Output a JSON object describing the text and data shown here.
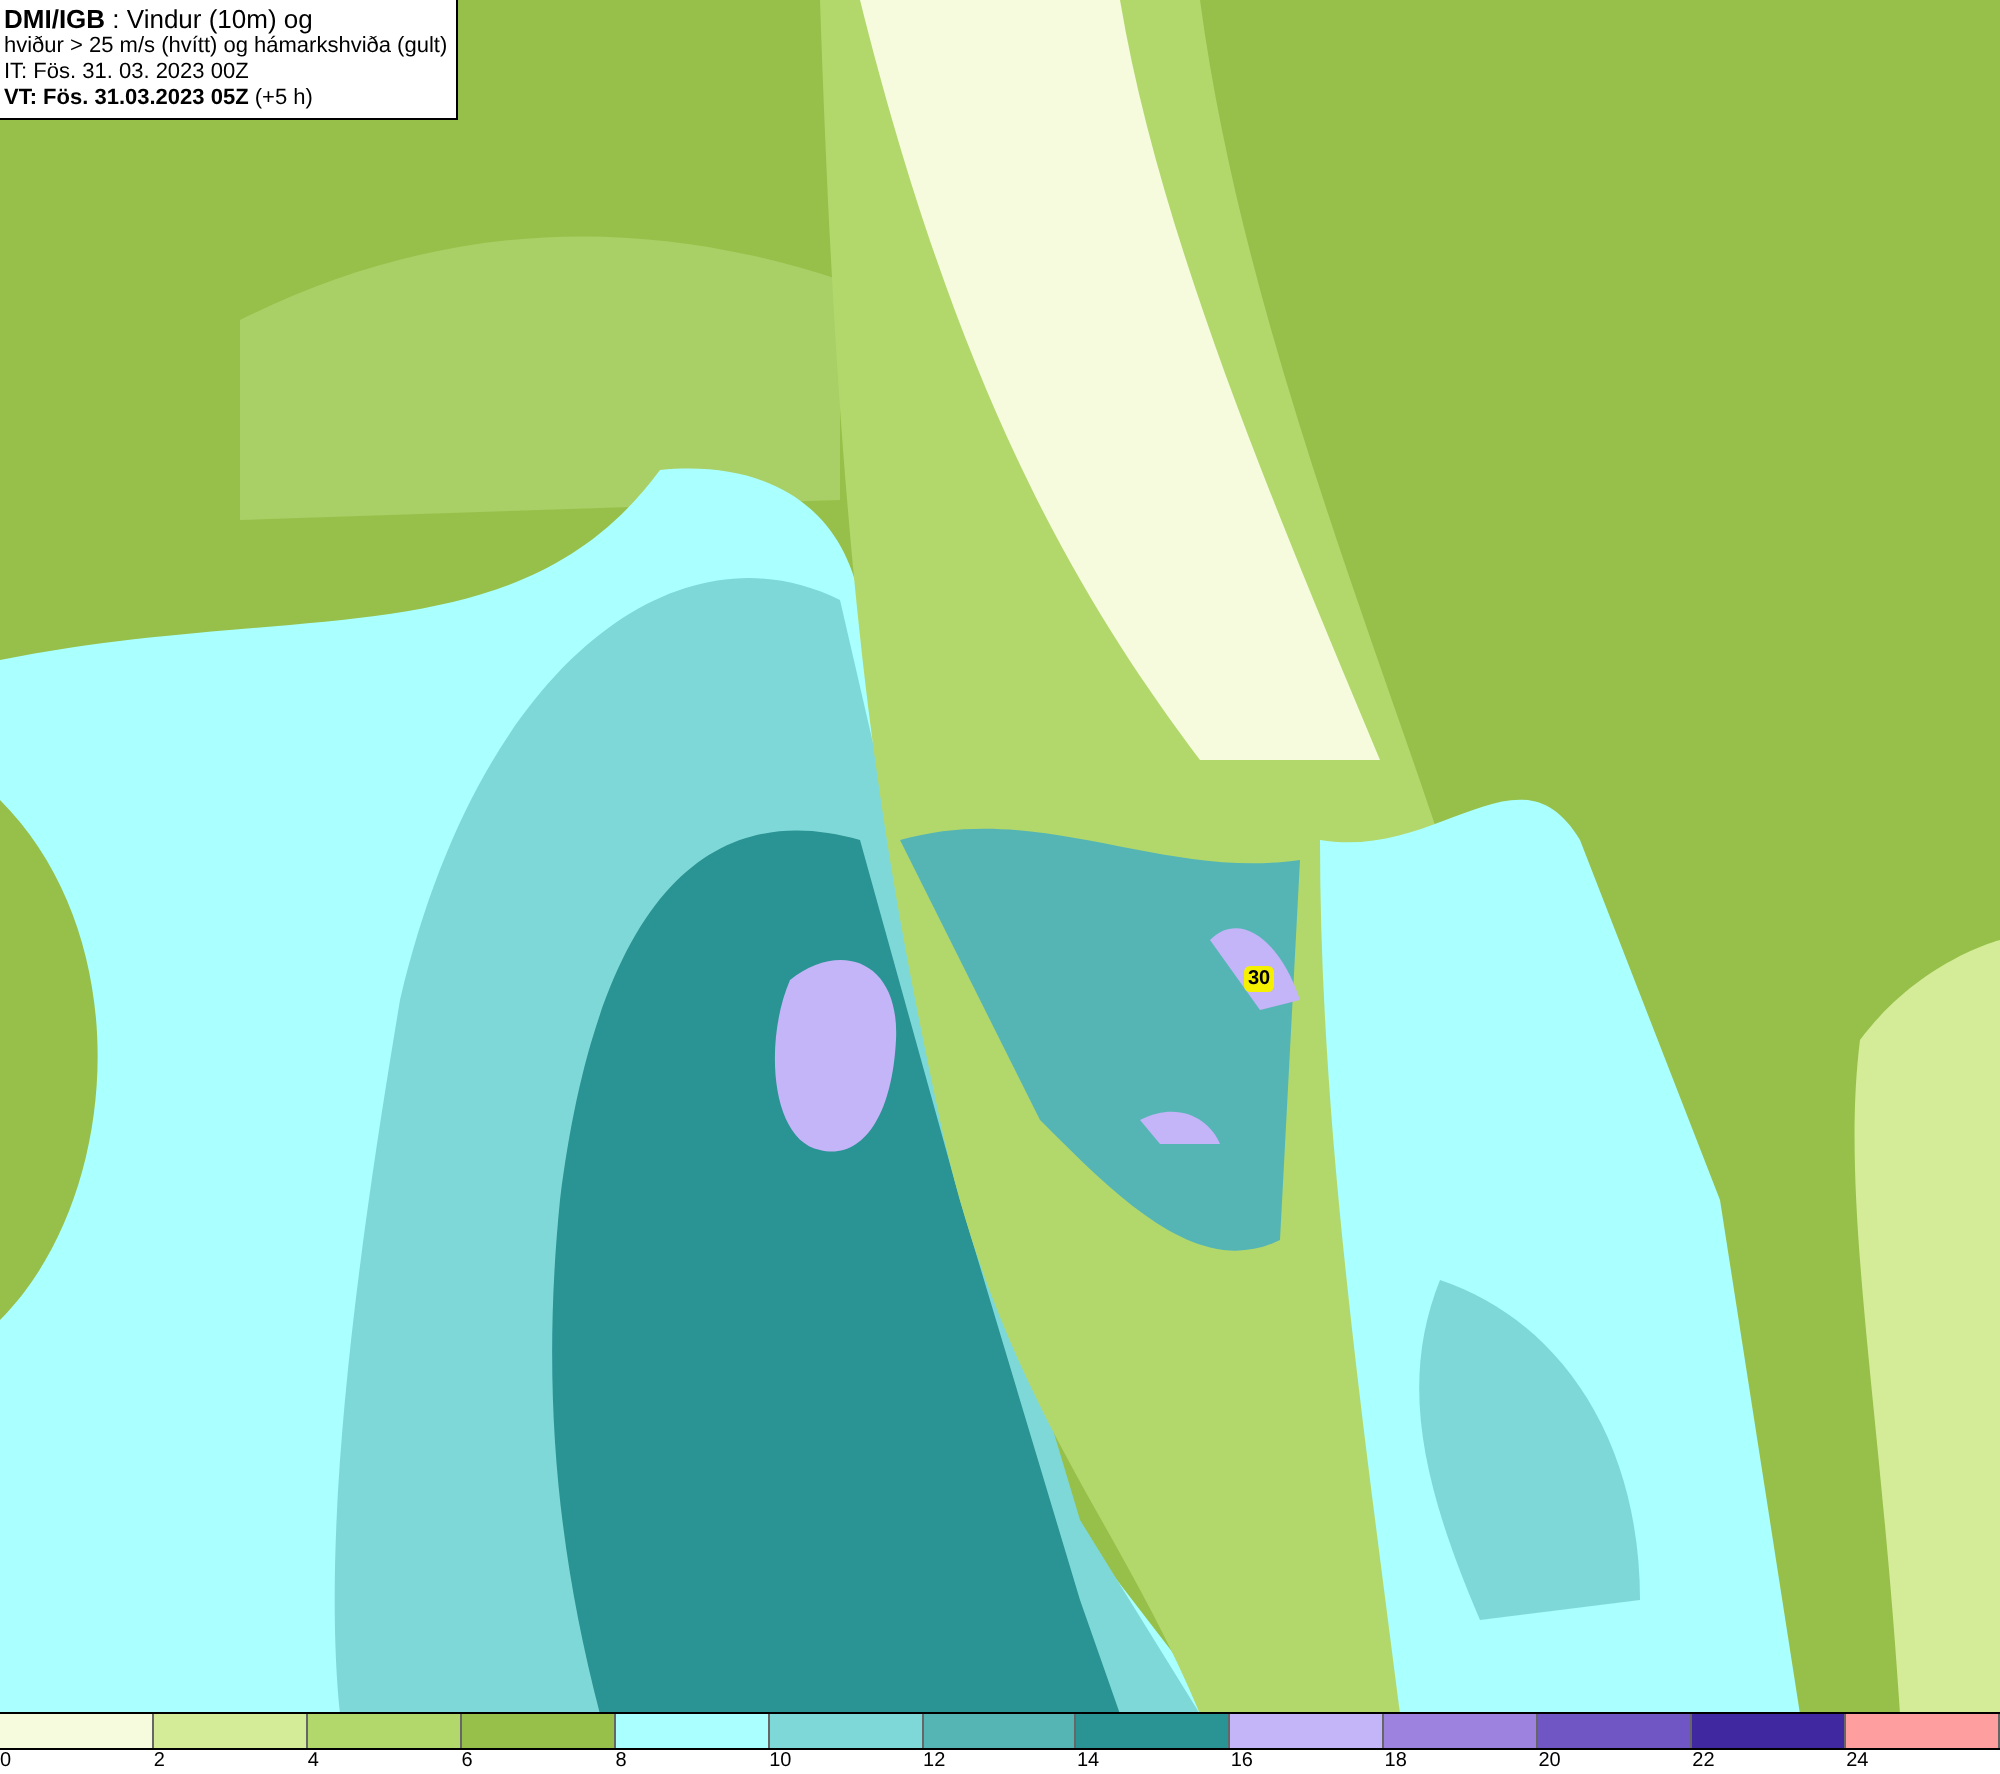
{
  "header": {
    "lines": [
      "**DMI/IGB** : Vindur (10m) og",
      "hviður > 25 m/s (hvítt) og hámarkshviða (gult)",
      "IT: Fös. 31. 03. 2023 00Z",
      "**VT: Fös. 31.03.2023 05Z** (+5 h)"
    ]
  },
  "map": {
    "max_gust": "30"
  },
  "legend": {
    "swatches": [
      {
        "color": "#f5fbdc"
      },
      {
        "color": "#d4ec98"
      },
      {
        "color": "#b2d86c"
      },
      {
        "color": "#97c04a"
      },
      {
        "color": "#aaffff"
      },
      {
        "color": "#7fd8d8"
      },
      {
        "color": "#55b5b5"
      },
      {
        "color": "#2a9393"
      },
      {
        "color": "#c4b4f8"
      },
      {
        "color": "#9d82e0"
      },
      {
        "color": "#7055c4"
      },
      {
        "color": "#4028a0"
      },
      {
        "color": "#ff9e9e"
      }
    ],
    "ticks": [
      "0",
      "2",
      "4",
      "6",
      "8",
      "10",
      "12",
      "14",
      "16",
      "18",
      "20",
      "22",
      "24"
    ]
  }
}
